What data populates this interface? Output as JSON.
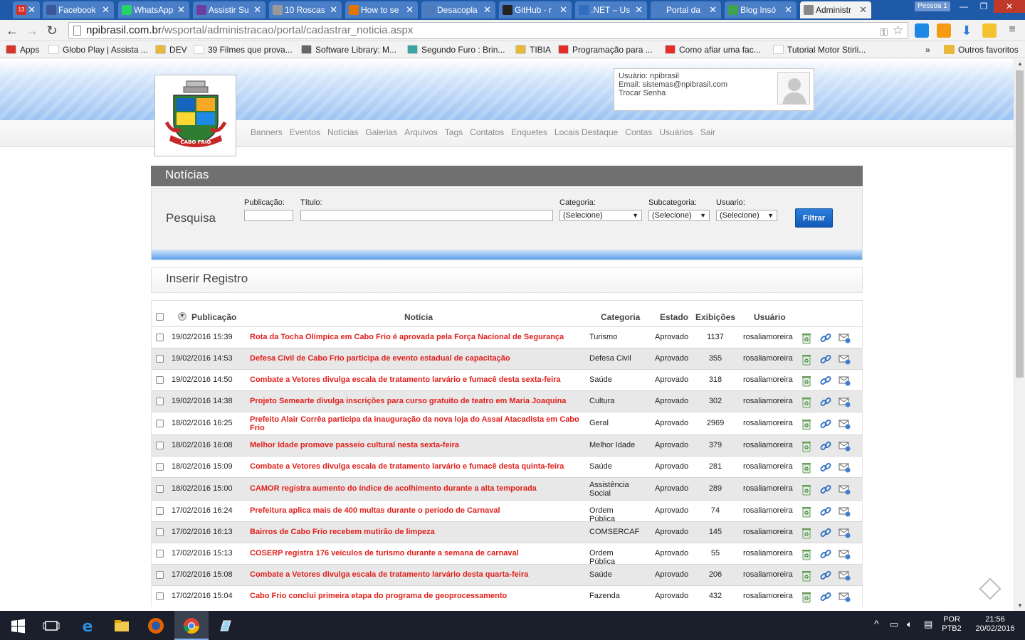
{
  "browser": {
    "tabs": [
      {
        "label": "",
        "icon": "gmail-icon",
        "color": "#d93025",
        "badge": "13"
      },
      {
        "label": "Facebook",
        "icon": "facebook-icon",
        "color": "#3b5998"
      },
      {
        "label": "WhatsApp",
        "icon": "whatsapp-icon",
        "color": "#25d366"
      },
      {
        "label": "Assistir Su",
        "icon": "video-icon",
        "color": "#6b3fa0"
      },
      {
        "label": "10 Roscas",
        "icon": "page-icon",
        "color": "#999999"
      },
      {
        "label": "How to se",
        "icon": "page-icon",
        "color": "#e37400"
      },
      {
        "label": "Desacopla",
        "icon": "page-icon",
        "color": "#4f7ab8"
      },
      {
        "label": "GitHub - r",
        "icon": "github-icon",
        "color": "#222222"
      },
      {
        "label": ".NET – Us",
        "icon": "page-icon",
        "color": "#2f6fbf"
      },
      {
        "label": "Portal da",
        "icon": "page-icon",
        "color": "#4a7fc8"
      },
      {
        "label": "Blog Insó",
        "icon": "page-icon",
        "color": "#3fa34d"
      },
      {
        "label": "Administr",
        "icon": "page-icon",
        "color": "#888888",
        "active": true
      }
    ],
    "person": "Pessoa 1",
    "url_host": "npibrasil.com.br",
    "url_path": "/wsportal/administracao/portal/cadastrar_noticia.aspx",
    "bookmarks": [
      {
        "label": "Apps",
        "icon": "apps-icon",
        "color": "#d9342b"
      },
      {
        "label": "Globo Play | Assista ...",
        "icon": "globo-icon",
        "color": "#ffffff"
      },
      {
        "label": "DEV",
        "icon": "folder-icon",
        "color": "#e8b838"
      },
      {
        "label": "39 Filmes que prova...",
        "icon": "page-icon",
        "color": "#ffffff"
      },
      {
        "label": "Software Library: M...",
        "icon": "archive-icon",
        "color": "#666666"
      },
      {
        "label": "Segundo Furo : Brin...",
        "icon": "page-icon",
        "color": "#3aa3a3"
      },
      {
        "label": "TIBIA",
        "icon": "folder-icon",
        "color": "#e8b838"
      },
      {
        "label": "Programação para ...",
        "icon": "youtube-icon",
        "color": "#e52d27"
      },
      {
        "label": "Como afiar uma fac...",
        "icon": "youtube-icon",
        "color": "#e52d27"
      },
      {
        "label": "Tutorial Motor Stirli...",
        "icon": "page-icon",
        "color": "#ffffff"
      }
    ],
    "bookmarks_more": "»",
    "other_bookmarks": "Outros favoritos"
  },
  "header": {
    "logo_text": "CABO FRIO",
    "user_label": "Usuário: npibrasil",
    "email_label": "Email: sistemas@npibrasil.com",
    "change_password": "Trocar Senha",
    "menu": [
      "Banners",
      "Eventos",
      "Notícias",
      "Galerias",
      "Arquivos",
      "Tags",
      "Contatos",
      "Enquetes",
      "Locais Destaque",
      "Contas",
      "Usuários",
      "Sair"
    ]
  },
  "section_title": "Notícias",
  "search": {
    "heading": "Pesquisa",
    "publicacao_label": "Publicação:",
    "titulo_label": "Título:",
    "categoria_label": "Categoria:",
    "subcategoria_label": "Subcategoria:",
    "usuario_label": "Usuario:",
    "categoria_value": "(Selecione)",
    "subcategoria_value": "(Selecione)",
    "usuario_value": "(Selecione)",
    "button": "Filtrar"
  },
  "insert_label": "Inserir Registro",
  "table": {
    "headers": {
      "publicacao": "Publicação",
      "noticia": "Notícia",
      "categoria": "Categoria",
      "estado": "Estado",
      "exibicoes": "Exibições",
      "usuario": "Usuário"
    },
    "rows": [
      {
        "date": "19/02/2016 15:39",
        "title": "Rota da Tocha Olímpica em Cabo Frio é aprovada pela Força Nacional de Segurança",
        "category": "Turismo",
        "status": "Aprovado",
        "views": "1137",
        "user": "rosaliamoreira"
      },
      {
        "date": "19/02/2016 14:53",
        "title": "Defesa Civil de Cabo Frio participa de evento estadual de capacitação",
        "category": "Defesa Civil",
        "status": "Aprovado",
        "views": "355",
        "user": "rosaliamoreira"
      },
      {
        "date": "19/02/2016 14:50",
        "title": "Combate a Vetores divulga escala de tratamento larvário e fumacê desta sexta-feira",
        "category": "Saúde",
        "status": "Aprovado",
        "views": "318",
        "user": "rosaliamoreira"
      },
      {
        "date": "19/02/2016 14:38",
        "title": "Projeto Semearte divulga inscrições para curso gratuito de teatro em Maria Joaquina",
        "category": "Cultura",
        "status": "Aprovado",
        "views": "302",
        "user": "rosaliamoreira"
      },
      {
        "date": "18/02/2016 16:25",
        "title": "Prefeito Alair Corrêa participa da inauguração da nova loja do Assaí Atacadista em Cabo Frio",
        "category": "Geral",
        "status": "Aprovado",
        "views": "2969",
        "user": "rosaliamoreira"
      },
      {
        "date": "18/02/2016 16:08",
        "title": "Melhor Idade promove passeio cultural nesta sexta-feira",
        "category": "Melhor Idade",
        "status": "Aprovado",
        "views": "379",
        "user": "rosaliamoreira"
      },
      {
        "date": "18/02/2016 15:09",
        "title": "Combate a Vetores divulga escala de tratamento larvário e fumacê desta quinta-feira",
        "category": "Saúde",
        "status": "Aprovado",
        "views": "281",
        "user": "rosaliamoreira"
      },
      {
        "date": "18/02/2016 15:00",
        "title": "CAMOR registra aumento do índice de acolhimento durante a alta temporada",
        "category": "Assistência Social",
        "status": "Aprovado",
        "views": "289",
        "user": "rosaliamoreira"
      },
      {
        "date": "17/02/2016 16:24",
        "title": "Prefeitura aplica mais de 400 multas durante o período de Carnaval",
        "category": "Ordem Pública",
        "status": "Aprovado",
        "views": "74",
        "user": "rosaliamoreira"
      },
      {
        "date": "17/02/2016 16:13",
        "title": "Bairros de Cabo Frio recebem mutirão de limpeza",
        "category": "COMSERCAF",
        "status": "Aprovado",
        "views": "145",
        "user": "rosaliamoreira"
      },
      {
        "date": "17/02/2016 15:13",
        "title": "COSERP registra 176 veículos de turismo durante a semana de carnaval",
        "category": "Ordem Pública",
        "status": "Aprovado",
        "views": "55",
        "user": "rosaliamoreira"
      },
      {
        "date": "17/02/2016 15:08",
        "title": "Combate a Vetores divulga escala de tratamento larvário desta quarta-feira",
        "category": "Saúde",
        "status": "Aprovado",
        "views": "206",
        "user": "rosaliamoreira"
      },
      {
        "date": "17/02/2016 15:04",
        "title": "Cabo Frio conclui primeira etapa do programa de geoprocessamento",
        "category": "Fazenda",
        "status": "Aprovado",
        "views": "432",
        "user": "rosaliamoreira"
      }
    ]
  },
  "taskbar": {
    "lang_top": "POR",
    "lang_bottom": "PTB2",
    "time": "21:56",
    "date": "20/02/2016"
  },
  "colors": {
    "link_red": "#e0201c",
    "header_blue": "#9cc3f2",
    "section_gray": "#707070",
    "button_blue": "#1158b5"
  }
}
